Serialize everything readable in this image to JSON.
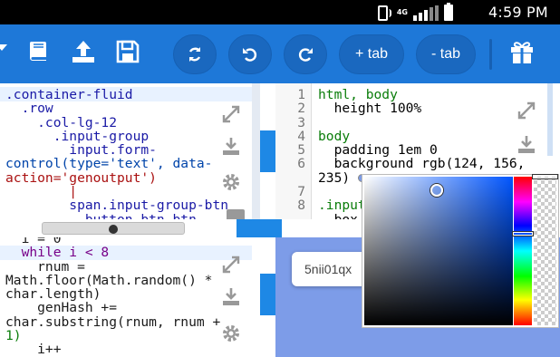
{
  "status": {
    "network": "4G",
    "time": "4:59 PM"
  },
  "toolbar": {
    "buttons": [
      "+ tab",
      "- tab"
    ],
    "icons": [
      "book-icon",
      "upload-icon",
      "save-icon",
      "refresh-icon",
      "undo-icon",
      "redo-icon",
      "gift-icon"
    ],
    "accent": "#1e78d8"
  },
  "html_editor": {
    "lines": [
      ".container-fluid",
      "  .row",
      "    .col-lg-12",
      "      .input-group",
      "        input.form-",
      "control(type='text', data-",
      "action='genoutput')",
      "        |",
      "        span.input-group-btn",
      "          button.btn.btn-"
    ]
  },
  "css_editor": {
    "line_numbers": [
      "1",
      "2",
      "3",
      "4",
      "5",
      "6",
      "",
      "7",
      "8"
    ],
    "lines": [
      "html, body",
      "  height 100%",
      "",
      "body",
      "  padding 1em 0",
      "  background rgb(124, 156,",
      "235)",
      "",
      ".input",
      "  box"
    ]
  },
  "js_editor": {
    "lines": [
      "  i = 0",
      "  while i < 8",
      "    rnum =",
      "Math.floor(Math.random() *",
      "char.length)",
      "    genHash +=",
      "char.substring(rnum, rnum +",
      "1)",
      "    i++"
    ]
  },
  "preview": {
    "output": "5nii01qx",
    "background": "#7c9ce8"
  },
  "color_picker": {
    "value": "rgb(124, 156, 235)"
  }
}
